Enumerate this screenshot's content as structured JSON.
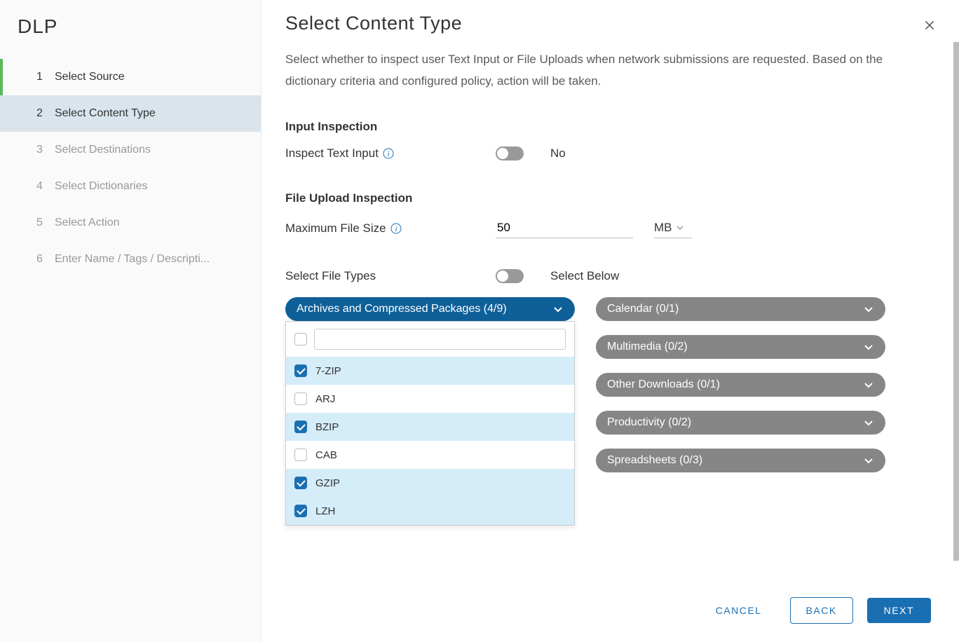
{
  "sidebar": {
    "title": "DLP",
    "steps": [
      {
        "num": "1",
        "label": "Select Source"
      },
      {
        "num": "2",
        "label": "Select Content Type"
      },
      {
        "num": "3",
        "label": "Select Destinations"
      },
      {
        "num": "4",
        "label": "Select Dictionaries"
      },
      {
        "num": "5",
        "label": "Select Action"
      },
      {
        "num": "6",
        "label": "Enter Name / Tags / Descripti..."
      }
    ]
  },
  "main": {
    "title": "Select Content Type",
    "description": "Select whether to inspect user Text Input or File Uploads when network submissions are requested. Based on the dictionary criteria and configured policy, action will be taken."
  },
  "input_inspection": {
    "section_title": "Input Inspection",
    "text_input_label": "Inspect Text Input",
    "text_input_value": "No"
  },
  "file_upload": {
    "section_title": "File Upload Inspection",
    "max_file_size_label": "Maximum File Size",
    "max_file_size_value": "50",
    "max_file_size_unit": "MB",
    "select_file_types_label": "Select File Types",
    "select_file_types_value": "Select Below"
  },
  "categories": {
    "archives": "Archives and Compressed Packages (4/9)",
    "calendar": "Calendar (0/1)",
    "multimedia": "Multimedia (0/2)",
    "other_downloads": "Other Downloads (0/1)",
    "productivity": "Productivity (0/2)",
    "spreadsheets": "Spreadsheets (0/3)"
  },
  "archive_items": [
    {
      "label": "7-ZIP",
      "checked": true
    },
    {
      "label": "ARJ",
      "checked": false
    },
    {
      "label": "BZIP",
      "checked": true
    },
    {
      "label": "CAB",
      "checked": false
    },
    {
      "label": "GZIP",
      "checked": true
    },
    {
      "label": "LZH",
      "checked": true
    }
  ],
  "footer": {
    "cancel": "CANCEL",
    "back": "BACK",
    "next": "NEXT"
  }
}
